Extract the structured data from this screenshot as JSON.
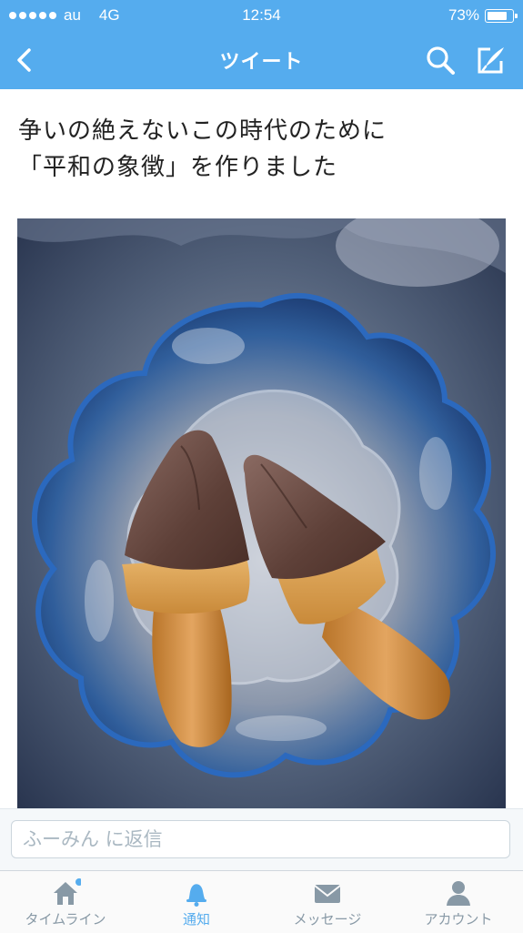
{
  "status_bar": {
    "carrier": "au",
    "network": "4G",
    "time": "12:54",
    "battery": "73%"
  },
  "nav": {
    "title": "ツイート",
    "back_icon": "chevron-left-icon",
    "search_icon": "search-icon",
    "compose_icon": "compose-icon"
  },
  "tweet": {
    "line1": "争いの絶えないこの時代のために",
    "line2": "「平和の象徴」を作りました"
  },
  "reply": {
    "placeholder": "ふーみん に返信"
  },
  "tabs": [
    {
      "label": "タイムライン",
      "icon": "home-icon",
      "active": false,
      "has_dot": true
    },
    {
      "label": "通知",
      "icon": "bell-icon",
      "active": true
    },
    {
      "label": "メッセージ",
      "icon": "envelope-icon",
      "active": false
    },
    {
      "label": "アカウント",
      "icon": "person-icon",
      "active": false
    }
  ],
  "colors": {
    "accent": "#55acee",
    "tab_inactive": "#8899a6"
  }
}
